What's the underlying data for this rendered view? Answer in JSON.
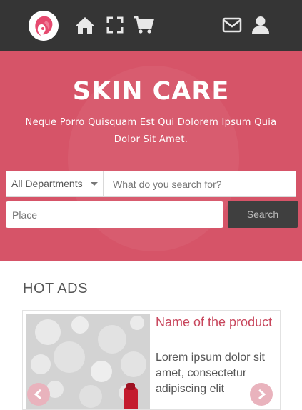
{
  "navbar": {
    "logo_icon": "woman-face-logo",
    "icons": [
      "home-icon",
      "fullscreen-icon",
      "cart-icon",
      "mail-icon",
      "user-icon"
    ],
    "background": "#353535"
  },
  "hero": {
    "title": "SKIN CARE",
    "subtitle": "Neque Porro Quisquam Est Qui Dolorem Ipsum Quia Dolor Sit Amet.",
    "background": "#d65468"
  },
  "search": {
    "department_selected": "All Departments",
    "keyword_placeholder": "What do you search for?",
    "place_placeholder": "Place",
    "button_label": "Search"
  },
  "hot_ads": {
    "section_title": "HOT ADS",
    "items": [
      {
        "title": "Name of the product",
        "description": "Lorem ipsum dolor sit amet, consectetur adipiscing elit"
      }
    ]
  },
  "colors": {
    "accent": "#c8465c",
    "dark": "#353535"
  }
}
